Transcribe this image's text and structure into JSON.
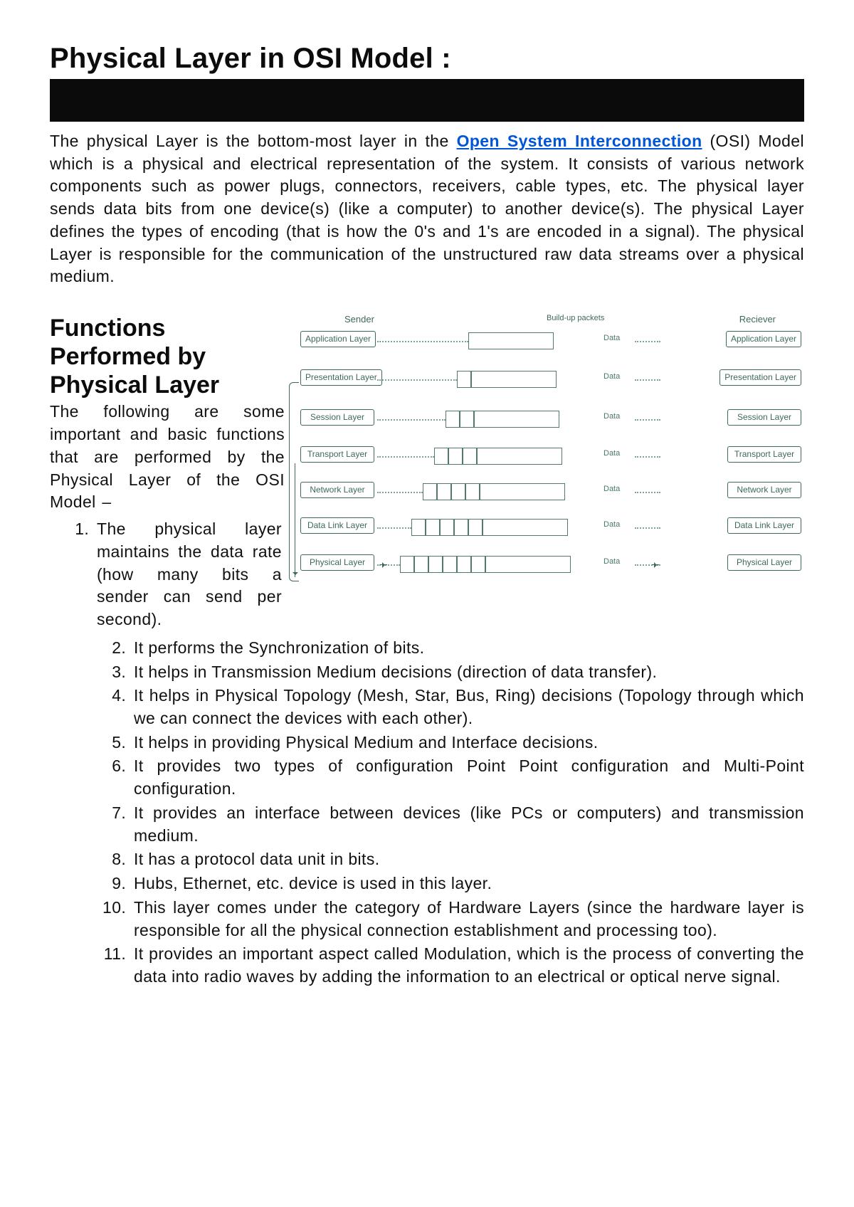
{
  "title": "Physical Layer in OSI Model :",
  "redacted_bullets": [
    "",
    "",
    ""
  ],
  "intro": {
    "pre": "The physical Layer is the bottom-most layer in the ",
    "link": "Open System Interconnection",
    "post": " (OSI) Model which is a physical and electrical representation of the system. It consists of various network components such as power plugs, connectors, receivers, cable types, etc. The physical layer sends data bits from one device(s) (like a computer) to another device(s). The physical Layer defines the types of encoding (that is how the 0's and 1's are encoded in a signal). The physical Layer is responsible for the communication of the unstructured raw data streams over a physical medium."
  },
  "subtitle": "Functions Performed by Physical Layer",
  "lead": "The following are some important and basic functions that are performed by the Physical Layer of the OSI Model –",
  "functions": [
    "The physical layer maintains the data rate (how many bits a sender can send per second).",
    "It performs the Synchronization of bits.",
    "It helps in Transmission Medium decisions (direction of data transfer).",
    "It helps in Physical Topology (Mesh, Star, Bus, Ring) decisions (Topology through which we can connect the devices with each other).",
    "It helps in providing Physical Medium and Interface decisions.",
    "It provides two types of configuration Point Point configuration and Multi-Point configuration.",
    "It provides an interface between devices (like PCs or computers) and transmission medium.",
    "It has a protocol data unit in bits.",
    "Hubs, Ethernet, etc. device is used in this layer.",
    "This layer comes under the category of Hardware Layers (since the hardware layer is responsible for all the physical connection establishment and processing too).",
    "It provides an important aspect called Modulation, which is the process of converting the data into radio waves by adding the information to an electrical or optical nerve signal."
  ],
  "chart_data": {
    "type": "table",
    "headers": {
      "sender": "Sender",
      "middle": "Build-up packets",
      "receiver": "Reciever"
    },
    "layers": [
      {
        "name": "Application Layer",
        "data_label": "Data",
        "segments": 1
      },
      {
        "name": "Presentation Layer",
        "data_label": "Data",
        "segments": 2
      },
      {
        "name": "Session Layer",
        "data_label": "Data",
        "segments": 3
      },
      {
        "name": "Transport Layer",
        "data_label": "Data",
        "segments": 4
      },
      {
        "name": "Network Layer",
        "data_label": "Data",
        "segments": 5
      },
      {
        "name": "Data Link Layer",
        "data_label": "Data",
        "segments": 6
      },
      {
        "name": "Physical Layer",
        "data_label": "Data",
        "segments": 7
      }
    ]
  }
}
